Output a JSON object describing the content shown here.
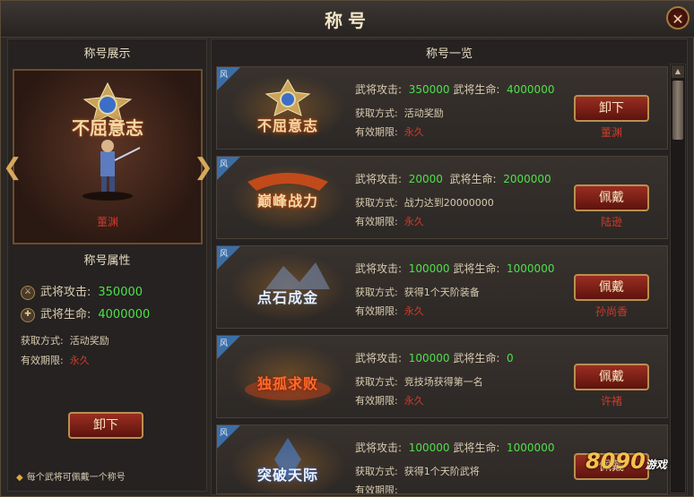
{
  "window": {
    "title": "称号",
    "close_label": "✕"
  },
  "left": {
    "showcase_heading": "称号展示",
    "showcase_title_name": "不屈意志",
    "showcase_owner": "董渊",
    "attrs_heading": "称号属性",
    "stats": [
      {
        "label": "武将攻击:",
        "value": "350000"
      },
      {
        "label": "武将生命:",
        "value": "4000000"
      }
    ],
    "acquire_label": "获取方式:",
    "acquire_value": "活动奖励",
    "valid_label": "有效期限:",
    "valid_value": "永久",
    "unequip_label": "卸下",
    "tip": "每个武将可佩戴一个称号"
  },
  "right": {
    "heading": "称号一览",
    "cards": [
      {
        "ribbon": "风",
        "name": "不屈意志",
        "atk_label": "武将攻击:",
        "atk": "350000",
        "hp_label": "武将生命:",
        "hp": "4000000",
        "acq_label": "获取方式:",
        "acq": "活动奖励",
        "valid_label": "有效期限:",
        "valid": "永久",
        "button": "卸下",
        "owner": "董渊"
      },
      {
        "ribbon": "风",
        "name": "巅峰战力",
        "atk_label": "武将攻击:",
        "atk": "20000",
        "hp_label": "武将生命:",
        "hp": "2000000",
        "acq_label": "获取方式:",
        "acq": "战力达到20000000",
        "valid_label": "有效期限:",
        "valid": "永久",
        "button": "佩戴",
        "owner": "陆逊"
      },
      {
        "ribbon": "风",
        "name": "点石成金",
        "atk_label": "武将攻击:",
        "atk": "100000",
        "hp_label": "武将生命:",
        "hp": "1000000",
        "acq_label": "获取方式:",
        "acq": "获得1个天阶装备",
        "valid_label": "有效期限:",
        "valid": "永久",
        "button": "佩戴",
        "owner": "孙尚香"
      },
      {
        "ribbon": "风",
        "name": "独孤求败",
        "atk_label": "武将攻击:",
        "atk": "100000",
        "hp_label": "武将生命:",
        "hp": "0",
        "acq_label": "获取方式:",
        "acq": "竞技场获得第一名",
        "valid_label": "有效期限:",
        "valid": "永久",
        "button": "佩戴",
        "owner": "许褚"
      },
      {
        "ribbon": "风",
        "name": "突破天际",
        "atk_label": "武将攻击:",
        "atk": "100000",
        "hp_label": "武将生命:",
        "hp": "1000000",
        "acq_label": "获取方式:",
        "acq": "获得1个天阶武将",
        "valid_label": "有效期限:",
        "valid": "",
        "button": "佩戴",
        "owner": ""
      }
    ]
  },
  "watermark": {
    "digits": "8090",
    "text": "游戏"
  },
  "colors": {
    "green_value": "#4ee04a",
    "red_owner": "#d23a2a",
    "ribbon_blue": "#3c6ea6",
    "button_red": "#9a2e22"
  }
}
